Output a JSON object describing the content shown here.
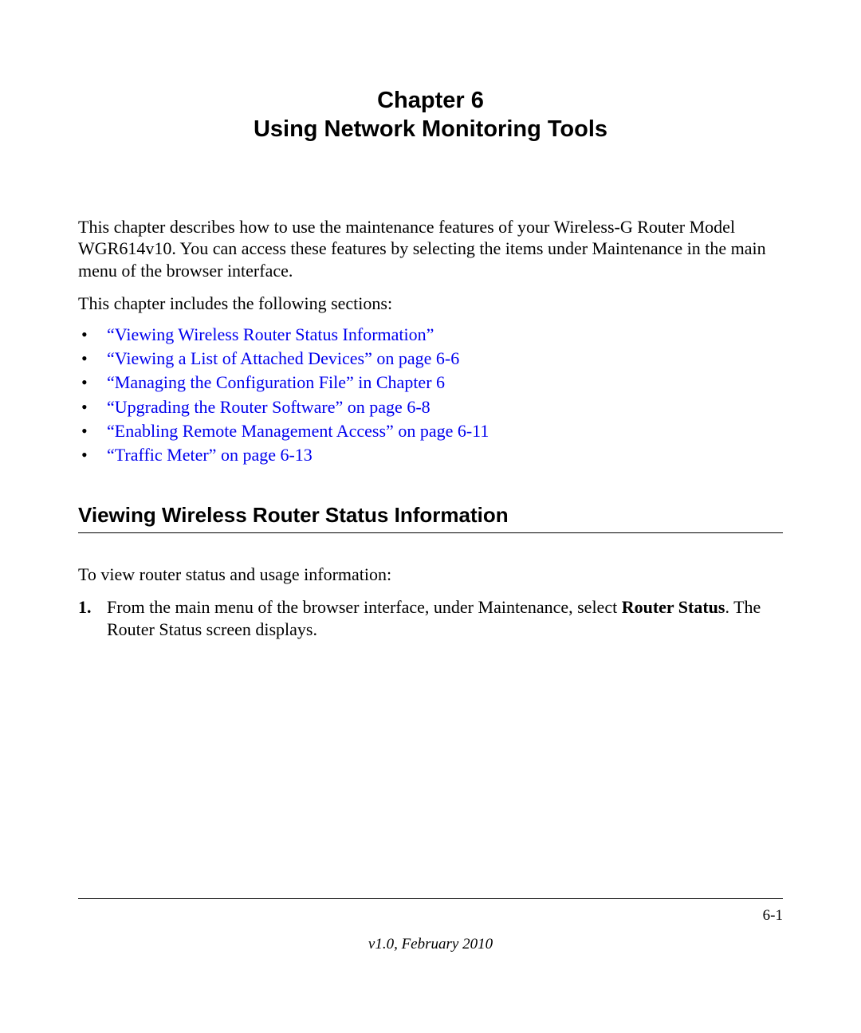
{
  "chapter": {
    "label": "Chapter 6",
    "title": "Using Network Monitoring Tools"
  },
  "intro": "This chapter describes how to use the maintenance features of your Wireless-G Router Model WGR614v10. You can access these features by selecting the items under Maintenance in the main menu of the browser interface.",
  "lead": "This chapter includes the following sections:",
  "toc": [
    "“Viewing Wireless Router Status Information”",
    "“Viewing a List of Attached Devices” on page 6-6",
    "“Managing the Configuration File” in Chapter 6",
    "“Upgrading the Router Software” on page 6-8",
    "“Enabling Remote Management Access” on page 6-11",
    "“Traffic Meter” on page 6-13"
  ],
  "section1": {
    "heading": "Viewing Wireless Router Status Information",
    "intro": "To view router status and usage information:",
    "steps": {
      "num1": "1.",
      "step1_pre": "From the main menu of the browser interface, under Maintenance, select ",
      "step1_bold": "Router Status",
      "step1_post": ". The Router Status screen displays."
    }
  },
  "footer": {
    "page": "6-1",
    "version": "v1.0, February 2010"
  }
}
